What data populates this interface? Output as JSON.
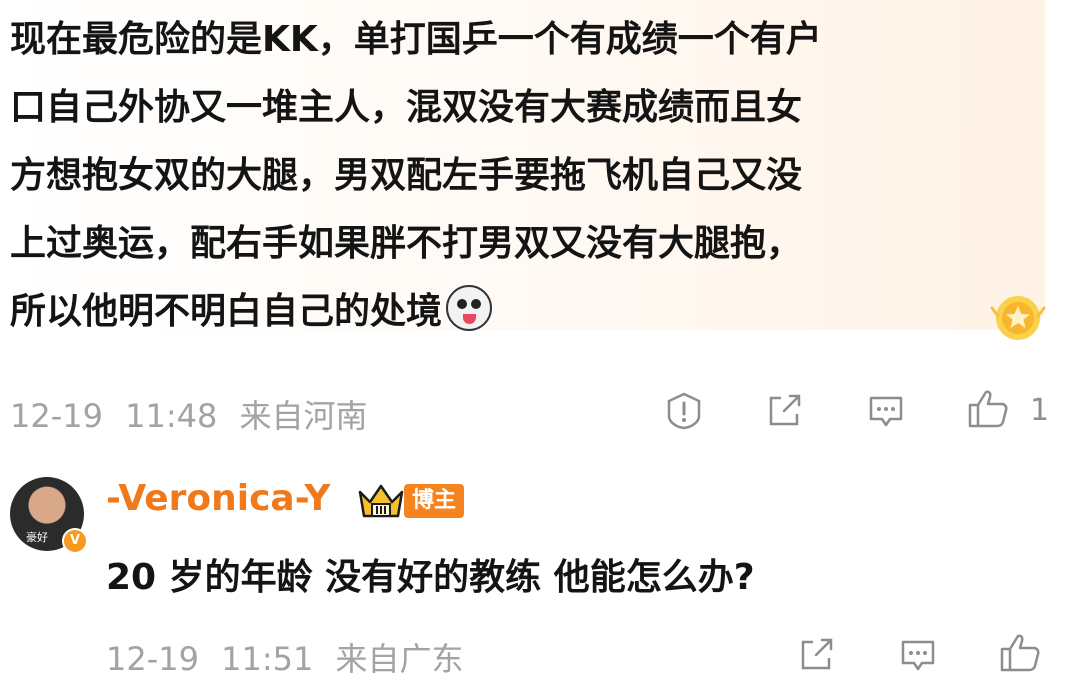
{
  "comment": {
    "lines": [
      "现在最危险的是KK，单打国乒一个有成绩一个有户",
      "口自己外协又一堆主人，混双没有大赛成绩而且女",
      "方想抱女双的大腿，男双配左手要拖飞机自己又没",
      "上过奥运，配右手如果胖不打男双又没有大腿抱，",
      "所以他明不明白自己的处境"
    ],
    "emoji": "husky-emoji",
    "badge": "star-badge-icon"
  },
  "meta": {
    "date": "12-19",
    "time": "11:48",
    "location": "来自河南",
    "like_count": "1"
  },
  "reply": {
    "username": "-Veronica-Y",
    "tag": "博主",
    "avatar_label": "豪好",
    "text": "20 岁的年龄 没有好的教练 他能怎么办?",
    "date": "12-19",
    "time": "11:51",
    "location": "来自广东"
  },
  "colors": {
    "accent": "#f0791b",
    "muted": "#a3a3a3",
    "icon": "#8d8d8d"
  }
}
